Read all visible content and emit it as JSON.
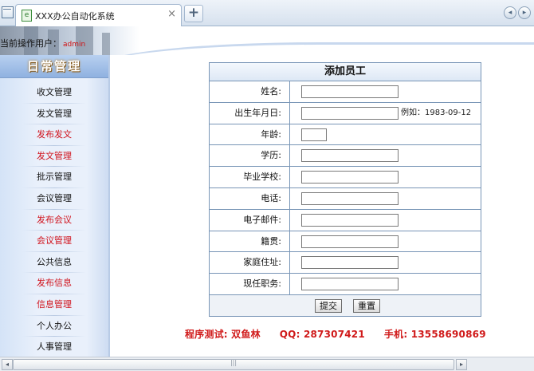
{
  "browser": {
    "tab_title": "XXX办公自动化系统",
    "close_glyph": "×",
    "new_tab_glyph": "+",
    "back_glyph": "◂",
    "forward_glyph": "▸"
  },
  "header": {
    "current_user_label": "当前操作用户：",
    "current_user": "admin"
  },
  "sidebar": {
    "title": "日常管理",
    "items": [
      {
        "label": "收文管理",
        "highlight": false
      },
      {
        "label": "发文管理",
        "highlight": false
      },
      {
        "label": "发布发文",
        "highlight": true
      },
      {
        "label": "发文管理",
        "highlight": true
      },
      {
        "label": "批示管理",
        "highlight": false
      },
      {
        "label": "会议管理",
        "highlight": false
      },
      {
        "label": "发布会议",
        "highlight": true
      },
      {
        "label": "会议管理",
        "highlight": true
      },
      {
        "label": "公共信息",
        "highlight": false
      },
      {
        "label": "发布信息",
        "highlight": true
      },
      {
        "label": "信息管理",
        "highlight": true
      },
      {
        "label": "个人办公",
        "highlight": false
      },
      {
        "label": "人事管理",
        "highlight": false
      }
    ]
  },
  "form": {
    "title": "添加员工",
    "fields": [
      {
        "label": "姓名:",
        "value": ""
      },
      {
        "label": "出生年月日:",
        "value": "",
        "hint": "例如：1983-09-12"
      },
      {
        "label": "年龄:",
        "value": ""
      },
      {
        "label": "学历:",
        "value": ""
      },
      {
        "label": "毕业学校:",
        "value": ""
      },
      {
        "label": "电话:",
        "value": ""
      },
      {
        "label": "电子邮件:",
        "value": ""
      },
      {
        "label": "籍贯:",
        "value": ""
      },
      {
        "label": "家庭住址:",
        "value": ""
      },
      {
        "label": "现任职务:",
        "value": ""
      }
    ],
    "submit_label": "提交",
    "reset_label": "重置"
  },
  "footer": {
    "tester": "程序测试: 双鱼林",
    "qq": "QQ: 287307421",
    "phone": "手机: 13558690869"
  },
  "colors": {
    "accent_red": "#d0101a",
    "sidebar_bg": "#e9f0fb",
    "table_border": "#7895b6"
  }
}
